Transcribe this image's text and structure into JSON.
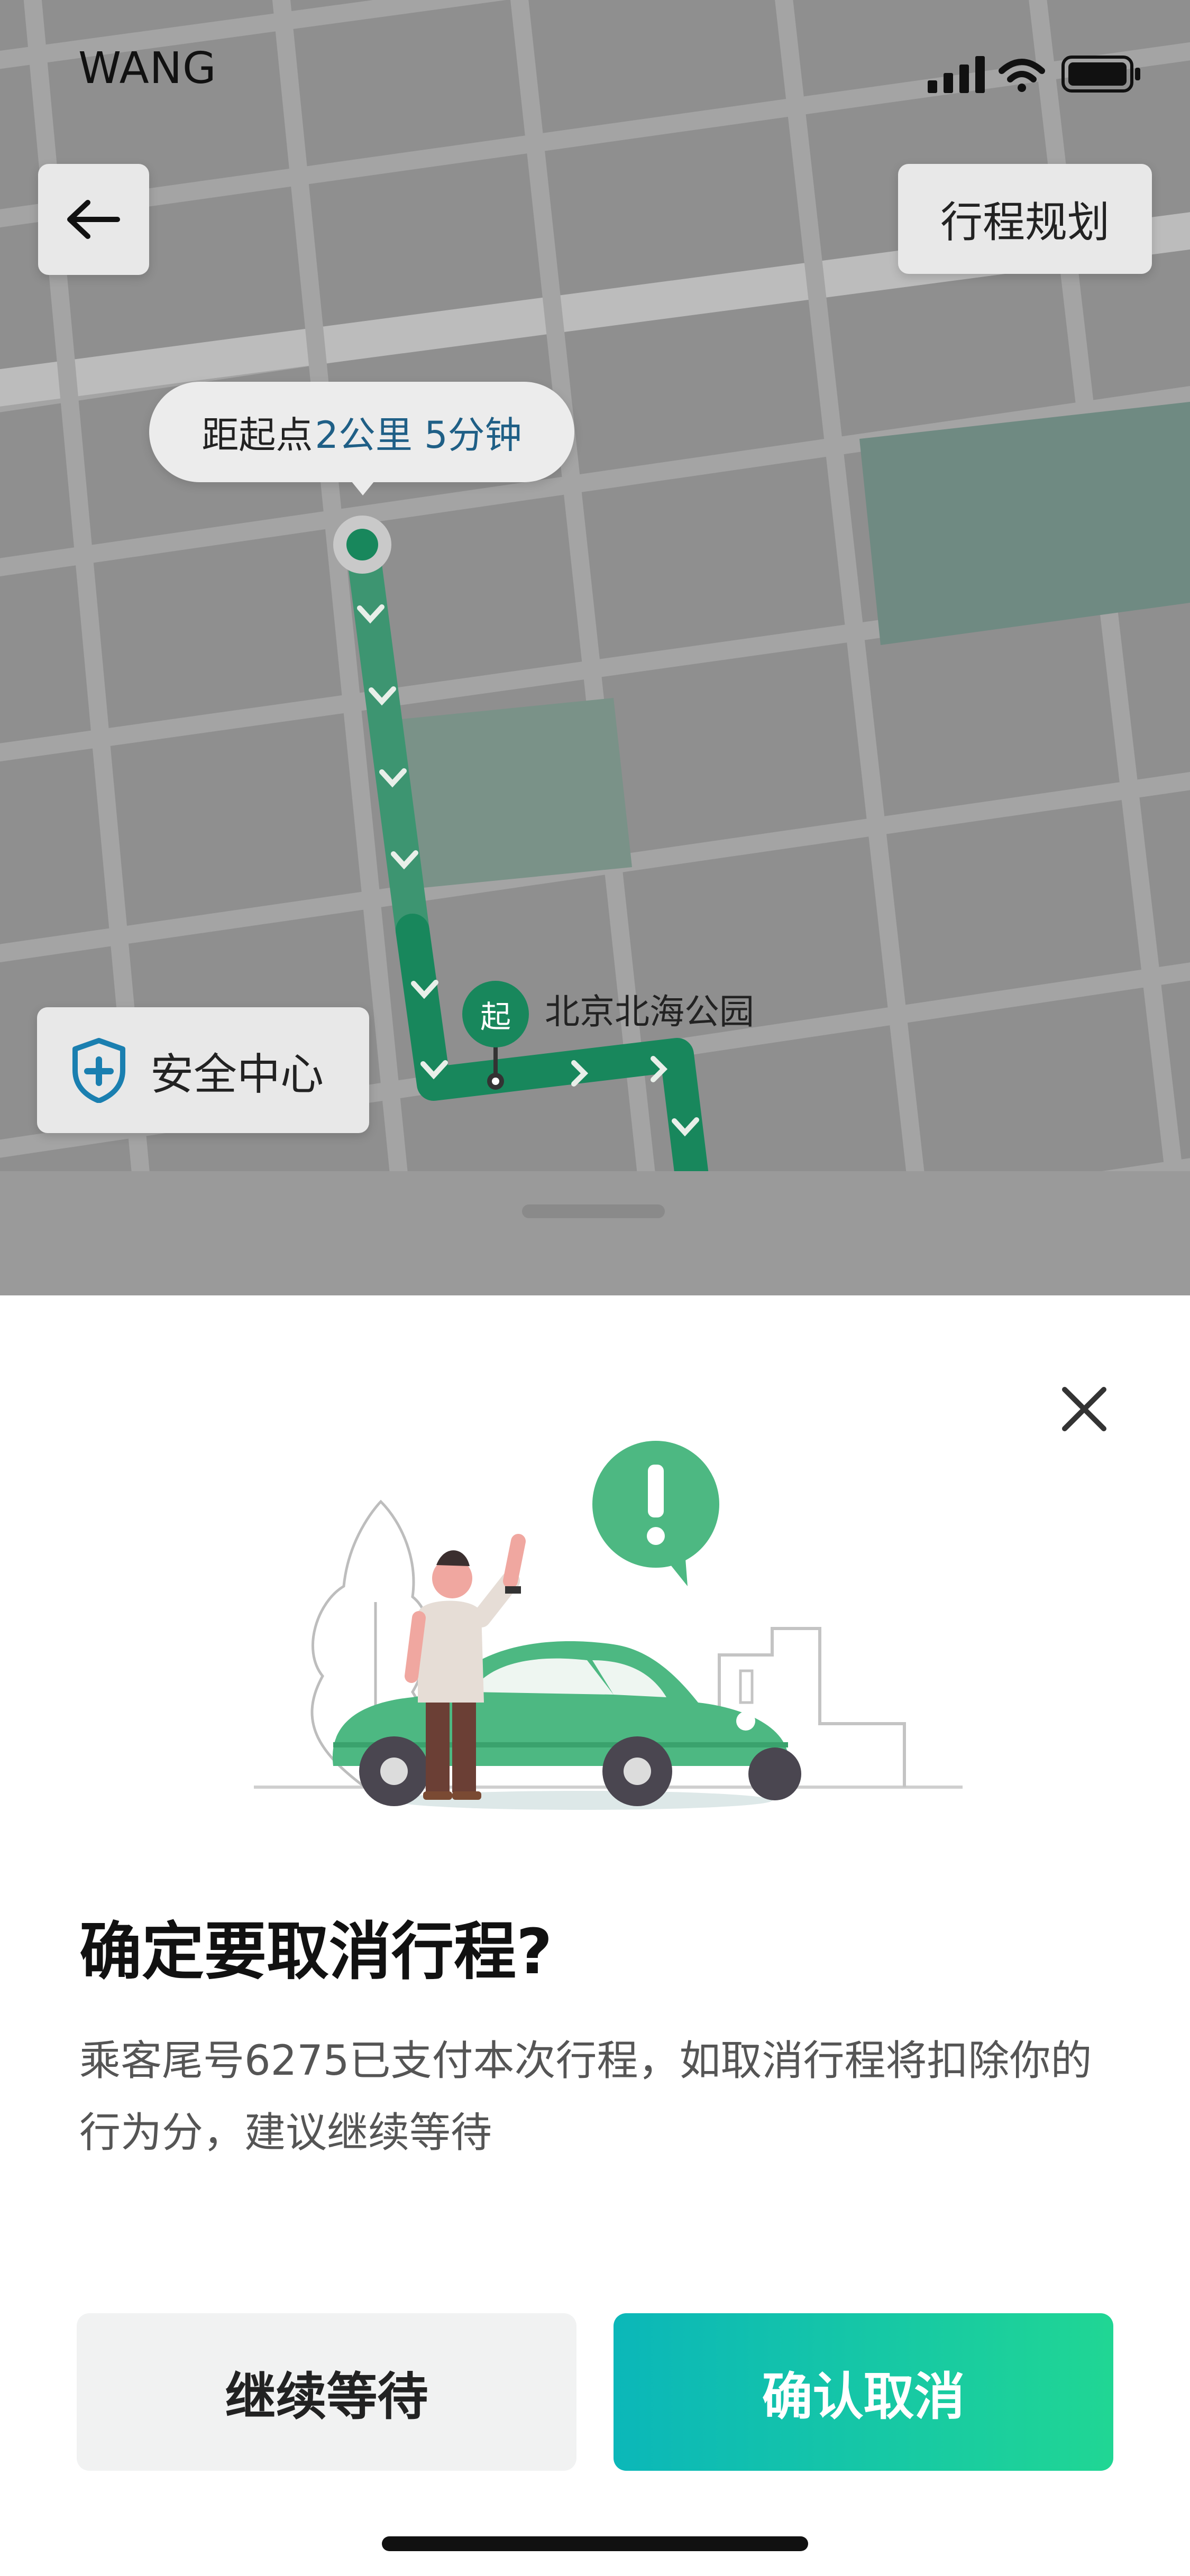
{
  "status_bar": {
    "carrier": "WANG"
  },
  "map": {
    "back_icon": "arrow-left-icon",
    "plan_button": "行程规划",
    "distance_bubble": {
      "prefix": "距起点",
      "highlight": "2公里 5分钟"
    },
    "start_marker": "起",
    "destination": "北京北海公园",
    "safety_center": "安全中心",
    "colors": {
      "route": "#18875c",
      "map_bg": "#8f8f8f",
      "road": "#a5a5a5",
      "highlight_text": "#1f5f86"
    }
  },
  "dialog": {
    "close_icon": "close-icon",
    "title": "确定要取消行程?",
    "message": "乘客尾号6275已支付本次行程，如取消行程将扣除你的行为分，建议继续等待",
    "continue_button": "继续等待",
    "confirm_button": "确认取消",
    "colors": {
      "confirm_start": "#0bb7b9",
      "confirm_end": "#20d694",
      "accent_green": "#4db882"
    }
  }
}
